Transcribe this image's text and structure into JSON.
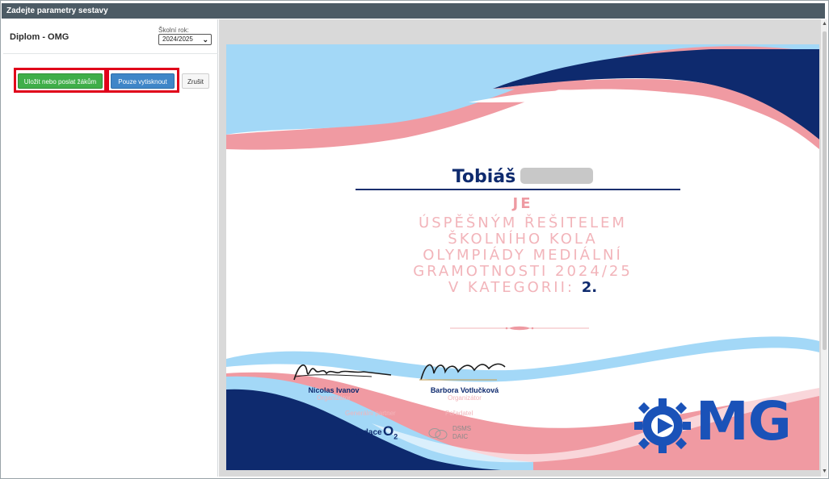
{
  "window": {
    "title": "Zadejte parametry sestavy"
  },
  "panel": {
    "title": "Diplom - OMG",
    "school_year_label": "Školní rok:",
    "school_year_value": "2024/2025"
  },
  "buttons": {
    "save_send": "Uložit nebo poslat žákům",
    "print_only": "Pouze vytisknout",
    "cancel": "Zrušit"
  },
  "diploma": {
    "recipient_first_name": "Tobiáš",
    "je": "JE",
    "body_lines": [
      "ÚSPĚŠNÝM ŘEŠITELEM",
      "ŠKOLNÍHO KOLA",
      "OLYMPIÁDY MEDIÁLNÍ",
      "GRAMOTNOSTI 2024/25"
    ],
    "category_label": "V KATEGORII:",
    "category_value": "2.",
    "signatories": [
      {
        "name": "Nicolas Ivanov",
        "role": "Organizátor"
      },
      {
        "name": "Barbora Votlučková",
        "role": "Organizátor"
      }
    ],
    "general_partner_label": "Generální partner",
    "organizer_label": "Pořadatel",
    "partner_text": "Nadace",
    "partner_brand": "O",
    "partner_brand_sub": "2",
    "organizer_line1": "DSMS",
    "organizer_line2": "DAIC",
    "logo_text": "MG"
  },
  "colors": {
    "pink": "#f09aa2",
    "light_blue": "#a3d8f7",
    "navy": "#0e2a6e",
    "logo_blue": "#1a52b8",
    "green_button": "#3fae49",
    "blue_button": "#3f86c8",
    "highlight": "#e0001a"
  }
}
